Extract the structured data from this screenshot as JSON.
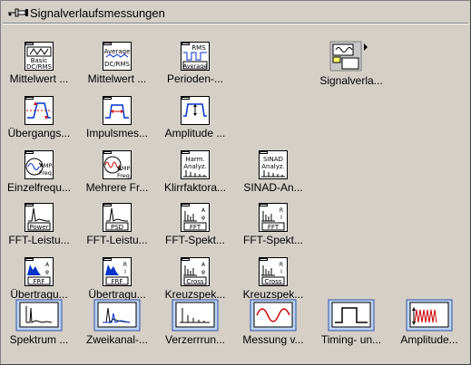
{
  "palette": {
    "title": "Signalverlaufsmessungen",
    "rows": [
      {
        "items": [
          {
            "label": "Mittelwert ...",
            "icon": "basic-dc-rms-icon",
            "icon_text": [
              "Basic",
              "DC/RMS"
            ]
          },
          {
            "label": "Mittelwert ...",
            "icon": "average-dc-rms-icon",
            "icon_text": [
              "Average",
              "DC/RMS"
            ]
          },
          {
            "label": "Perioden-...",
            "icon": "periodic-rms-icon",
            "icon_text": [
              "RMS",
              "Average"
            ]
          },
          {
            "label": "Signalverla...",
            "icon": "signal-subpalette-icon",
            "icon_text": []
          }
        ]
      },
      {
        "items": [
          {
            "label": "Übergangs...",
            "icon": "transition-measurement-icon",
            "icon_text": []
          },
          {
            "label": "Impulsmes...",
            "icon": "pulse-measurement-icon",
            "icon_text": []
          },
          {
            "label": "Amplitude ...",
            "icon": "amplitude-levels-icon",
            "icon_text": []
          }
        ]
      },
      {
        "items": [
          {
            "label": "Einzelfrequ...",
            "icon": "single-tone-icon",
            "icon_text": [
              "AMP.",
              "Freq."
            ]
          },
          {
            "label": "Mehrere Fr...",
            "icon": "multi-tone-icon",
            "icon_text": [
              "AMP.",
              "Freq."
            ]
          },
          {
            "label": "Klirrfaktora...",
            "icon": "harmonic-analyzer-icon",
            "icon_text": [
              "Harm.",
              "Analyz."
            ]
          },
          {
            "label": "SINAD-An...",
            "icon": "sinad-analyzer-icon",
            "icon_text": [
              "SINAD",
              "Analyz."
            ]
          }
        ]
      },
      {
        "items": [
          {
            "label": "FFT-Leistu...",
            "icon": "fft-power-spectrum-icon",
            "icon_text": [
              "Power"
            ]
          },
          {
            "label": "FFT-Leistu...",
            "icon": "fft-psd-icon",
            "icon_text": [
              "PSD"
            ]
          },
          {
            "label": "FFT-Spekt...",
            "icon": "fft-spectrum-mag-phase-icon",
            "icon_text": [
              "FFT"
            ]
          },
          {
            "label": "FFT-Spekt...",
            "icon": "fft-spectrum-real-imag-icon",
            "icon_text": [
              "FFT"
            ]
          }
        ]
      },
      {
        "items": [
          {
            "label": "Übertragu...",
            "icon": "frf-mag-phase-icon",
            "icon_text": [
              "FRF"
            ]
          },
          {
            "label": "Übertragu...",
            "icon": "frf-real-imag-icon",
            "icon_text": [
              "FRF"
            ]
          },
          {
            "label": "Kreuzspek...",
            "icon": "cross-spectrum-mag-phase-icon",
            "icon_text": [
              "Cross"
            ]
          },
          {
            "label": "Kreuzspek...",
            "icon": "cross-spectrum-real-imag-icon",
            "icon_text": [
              "Cross"
            ]
          }
        ]
      },
      {
        "items": [
          {
            "label": "Spektrum ...",
            "icon": "spectral-measurements-express-icon",
            "icon_text": []
          },
          {
            "label": "Zweikanal-...",
            "icon": "dual-channel-express-icon",
            "icon_text": []
          },
          {
            "label": "Verzerrrun...",
            "icon": "distortion-express-icon",
            "icon_text": []
          },
          {
            "label": "Messung v...",
            "icon": "tone-measurement-express-icon",
            "icon_text": []
          },
          {
            "label": "Timing- un...",
            "icon": "timing-transition-express-icon",
            "icon_text": []
          },
          {
            "label": "Amplitude...",
            "icon": "amplitude-level-express-icon",
            "icon_text": []
          }
        ]
      }
    ]
  },
  "colors": {
    "background": "#d4d0c8",
    "express_icon_bg": "#bcd4f4",
    "express_icon_border": "#3050a0",
    "plot_blue": "#0033cc",
    "plot_red": "#cc0000"
  }
}
